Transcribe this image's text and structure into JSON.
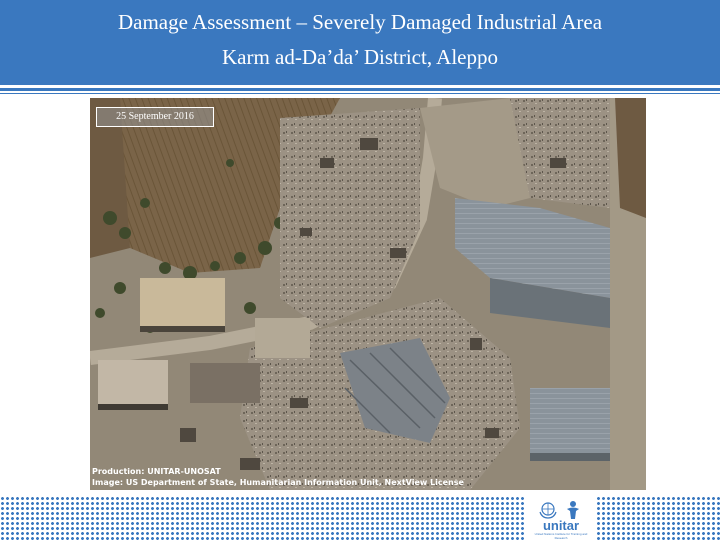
{
  "slide": {
    "title_line1": "Damage Assessment – Severely Damaged Industrial Area",
    "title_line2": "Karm ad-Da’da’ District, Aleppo",
    "accent_color": "#3a78bf"
  },
  "image": {
    "date_label": "25 September 2016",
    "credit_line1": "Production: UNITAR-UNOSAT",
    "credit_line2": "Image: US Department of State, Humanitarian Information Unit, NextView License"
  },
  "logo": {
    "wordmark": "unitar",
    "tagline": "United Nations Institute for Training and Research",
    "icons": [
      "un-emblem-icon",
      "person-icon"
    ]
  }
}
